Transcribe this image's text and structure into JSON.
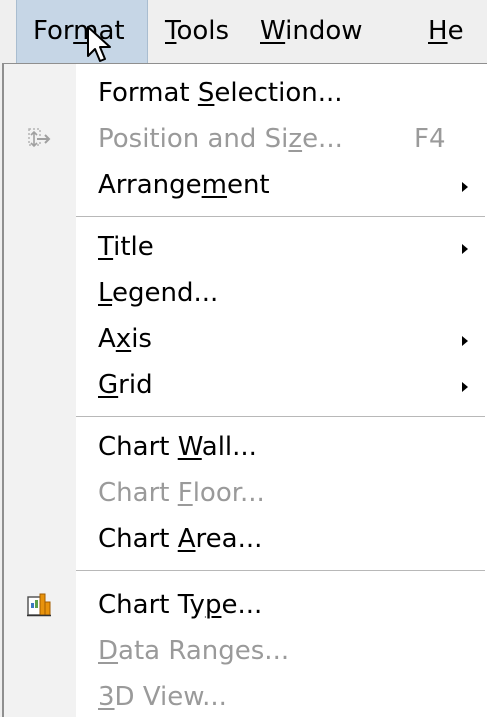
{
  "menubar": {
    "format": {
      "pre": "For",
      "acc": "m",
      "post": "at"
    },
    "tools": {
      "pre": "",
      "acc": "T",
      "post": "ools"
    },
    "window": {
      "pre": "",
      "acc": "W",
      "post": "indow"
    },
    "help": {
      "pre": "",
      "acc": "H",
      "post": "e"
    }
  },
  "menu": {
    "format_selection": {
      "pre": "Format ",
      "acc": "S",
      "post": "election..."
    },
    "position_size": {
      "pre": "Position and Si",
      "acc": "z",
      "post": "e...",
      "shortcut": "F4",
      "icon": "move-arrows-icon"
    },
    "arrangement": {
      "pre": "Arrange",
      "acc": "m",
      "post": "ent"
    },
    "title": {
      "pre": "",
      "acc": "T",
      "post": "itle"
    },
    "legend": {
      "pre": "",
      "acc": "L",
      "post": "egend..."
    },
    "axis": {
      "pre": "A",
      "acc": "x",
      "post": "is"
    },
    "grid": {
      "pre": "",
      "acc": "G",
      "post": "rid"
    },
    "chart_wall": {
      "pre": "Chart ",
      "acc": "W",
      "post": "all..."
    },
    "chart_floor": {
      "pre": "Chart ",
      "acc": "F",
      "post": "loor..."
    },
    "chart_area": {
      "pre": "Chart ",
      "acc": "A",
      "post": "rea..."
    },
    "chart_type": {
      "pre": "Chart Ty",
      "acc": "p",
      "post": "e...",
      "icon": "chart-type-icon"
    },
    "data_ranges": {
      "pre": "",
      "acc": "D",
      "post": "ata Ranges..."
    },
    "view_3d": {
      "pre": "",
      "acc": "3",
      "post": "D View..."
    }
  },
  "colors": {
    "active_menu_bg": "#c6d6e6",
    "disabled_text": "#9a9a9a",
    "chart_icon_orange": "#e8930c"
  }
}
